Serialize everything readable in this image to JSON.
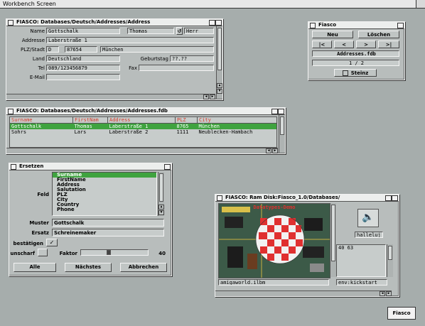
{
  "screen": {
    "title": "Workbench Screen"
  },
  "address_window": {
    "title": "FIASCO:  Databases/Deutsch/Addresses/Address",
    "labels": {
      "name": "Name",
      "address": "Addresse",
      "plz": "PLZ/Stadt",
      "land": "Land",
      "birthday": "Geburtstag",
      "tel": "Tel",
      "fax": "Fax",
      "email": "E-Mail"
    },
    "values": {
      "surname": "Gottschalk",
      "firstname": "Thomas",
      "title": "Herr",
      "street": "Laberstraße 1",
      "country_code": "D",
      "plz": "87654",
      "city": "München",
      "land": "Deutschland",
      "birthday": "??.??",
      "tel": "089/123456879",
      "fax": "",
      "email": ""
    }
  },
  "control_window": {
    "title": "Fiasco",
    "new_label": "Neu",
    "delete_label": "Löschen",
    "nav": [
      "|<",
      "<",
      ">",
      ">|"
    ],
    "file": "Addresses.fdb",
    "page": "1 / 2",
    "stop_label": "Steinz"
  },
  "list_window": {
    "title": "FIASCO:  Databases/Deutsch/Addresses/Addresses.fdb",
    "columns": [
      "Surname",
      "FirstNam",
      "Address",
      "PLZ",
      "City"
    ],
    "rows": [
      [
        "Gottschalk",
        "Thomas",
        "Laberstraße 1",
        "8765",
        "München"
      ],
      [
        "Sohrs",
        "Lars",
        "Laberstraße 2",
        "1111",
        "Neublecken-Hambach"
      ]
    ]
  },
  "replace_window": {
    "title": "Ersetzen",
    "field_label": "Feld",
    "fields": [
      "Surname",
      "FirstName",
      "Address",
      "Salutation",
      "PLZ",
      "City",
      "Country",
      "Phone"
    ],
    "search_label": "Muster",
    "search_value": "Gottschalk",
    "replace_label": "Ersatz",
    "replace_value": "Schreinemaker",
    "confirm_label": "bestätigen",
    "confirm_mark": "✓",
    "fuzzy_label": "unscharf",
    "factor_label": "Faktor",
    "factor_value": "40",
    "all_label": "Alle",
    "next_label": "Nächstes",
    "cancel_label": "Abbrechen"
  },
  "demo_window": {
    "title": "FIASCO:  Ram Disk:Fiasco_1.0/Databases/",
    "image_title": "Datatypes-Demo",
    "image_caption": "amigaworld.ilbm",
    "sound_label": "halleluj",
    "text_value": "40 63",
    "env_label": "env:kickstart"
  },
  "icon": {
    "label": "Fiasco"
  },
  "colors": {
    "selection": "#3fa33f",
    "header_red": "#d43a2a",
    "boing_red": "#e03030"
  }
}
